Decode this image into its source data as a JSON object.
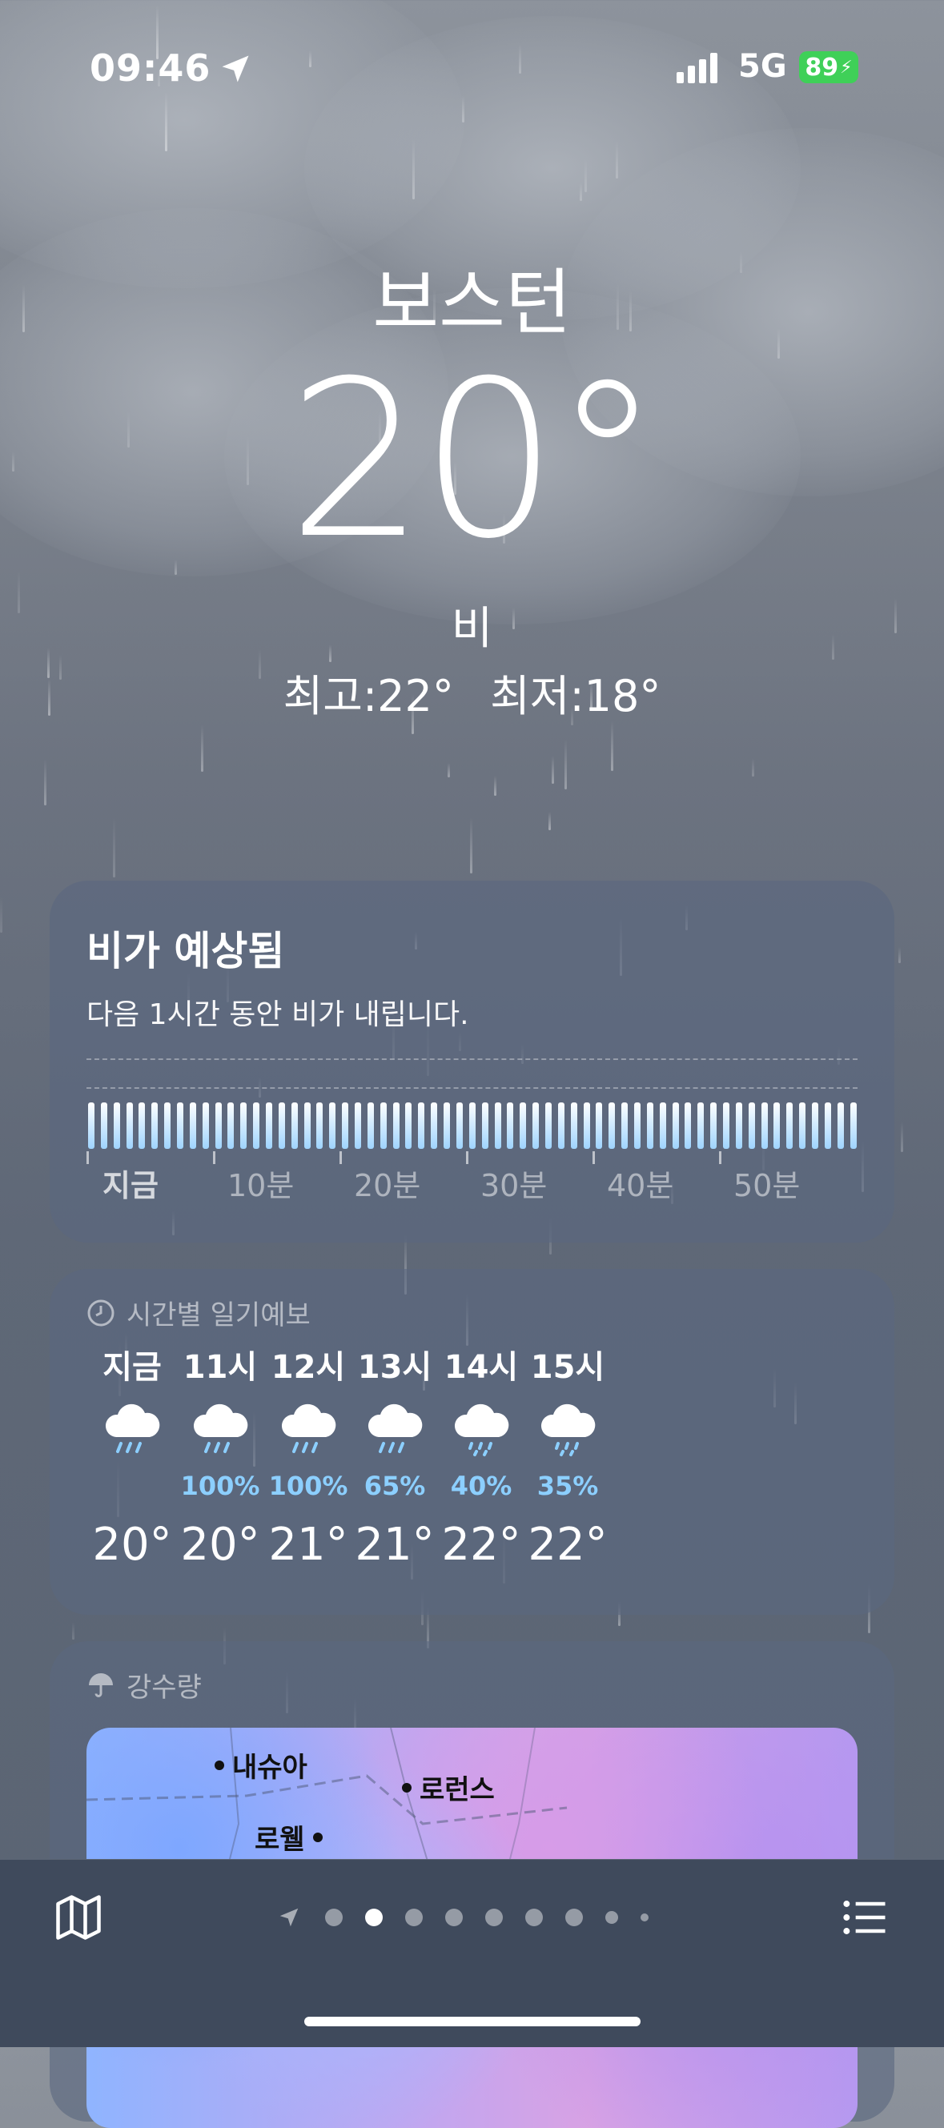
{
  "status_bar": {
    "time": "09:46",
    "network": "5G",
    "battery": "89"
  },
  "weather": {
    "city": "보스턴",
    "temperature": "20°",
    "condition": "비",
    "high": "최고:22°",
    "low": "최저:18°"
  },
  "rain_card": {
    "title": "비가 예상됨",
    "subtitle": "다음 1시간 동안 비가 내립니다.",
    "time_labels": [
      "지금",
      "10분",
      "20분",
      "30분",
      "40분",
      "50분"
    ]
  },
  "hourly_card": {
    "header": "시간별 일기예보",
    "hours": [
      {
        "label": "지금",
        "precip": "",
        "temp": "20°",
        "icon": "rain-cloud-icon"
      },
      {
        "label": "11시",
        "precip": "100%",
        "temp": "20°",
        "icon": "rain-cloud-icon"
      },
      {
        "label": "12시",
        "precip": "100%",
        "temp": "21°",
        "icon": "rain-cloud-icon"
      },
      {
        "label": "13시",
        "precip": "65%",
        "temp": "21°",
        "icon": "rain-cloud-icon"
      },
      {
        "label": "14시",
        "precip": "40%",
        "temp": "22°",
        "icon": "drizzle-cloud-icon"
      },
      {
        "label": "15시",
        "precip": "35%",
        "temp": "22°",
        "icon": "drizzle-cloud-icon"
      }
    ]
  },
  "precip_card": {
    "header": "강수량",
    "places": [
      "내슈아",
      "로런스",
      "로웰"
    ]
  },
  "colors": {
    "precip_text": "#8ccfff",
    "battery": "#3fd058",
    "card_bg": "rgba(90,103,128,0.62)"
  }
}
